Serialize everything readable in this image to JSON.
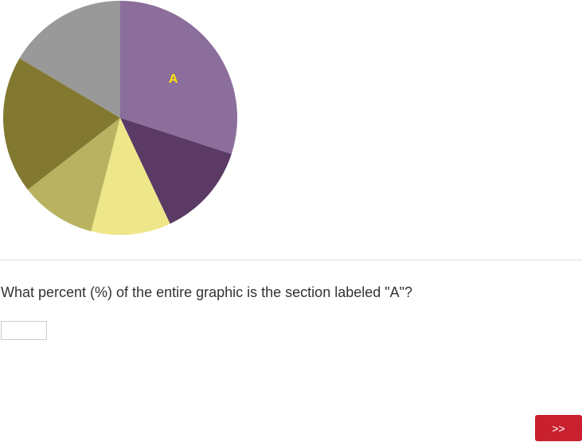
{
  "chart_data": {
    "type": "pie",
    "slices": [
      {
        "label": "A",
        "value": 30.0,
        "color": "#8b6e9b"
      },
      {
        "label": "",
        "value": 13.0,
        "color": "#5b3a65"
      },
      {
        "label": "",
        "value": 11.0,
        "color": "#ede78a"
      },
      {
        "label": "",
        "value": 10.5,
        "color": "#b9b361"
      },
      {
        "label": "",
        "value": 19.0,
        "color": "#827830"
      },
      {
        "label": "",
        "value": 16.5,
        "color": "#999999"
      }
    ],
    "label_color": "#ffe600",
    "start": "top",
    "direction": "clockwise"
  },
  "question": {
    "text": "What percent (%) of the entire graphic is the section labeled \"A\"?"
  },
  "answer": {
    "value": "",
    "placeholder": ""
  },
  "next_button": {
    "label": ">>",
    "color": "#c8202f"
  }
}
